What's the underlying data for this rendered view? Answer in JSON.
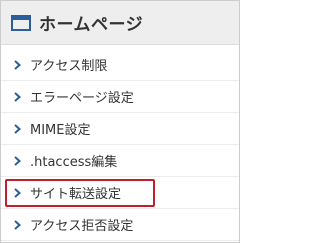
{
  "header": {
    "title": "ホームページ",
    "icon": "browser-window-icon",
    "icon_color": "#2b5d9a"
  },
  "menu": {
    "chevron_icon": "chevron-right-icon",
    "chevron_color": "#2b5d9a",
    "highlight_color": "#c0202a",
    "items": [
      {
        "label": "アクセス制限"
      },
      {
        "label": "エラーページ設定"
      },
      {
        "label": "MIME設定"
      },
      {
        "label": ".htaccess編集"
      },
      {
        "label": "サイト転送設定",
        "highlighted": true
      },
      {
        "label": "アクセス拒否設定"
      }
    ]
  }
}
